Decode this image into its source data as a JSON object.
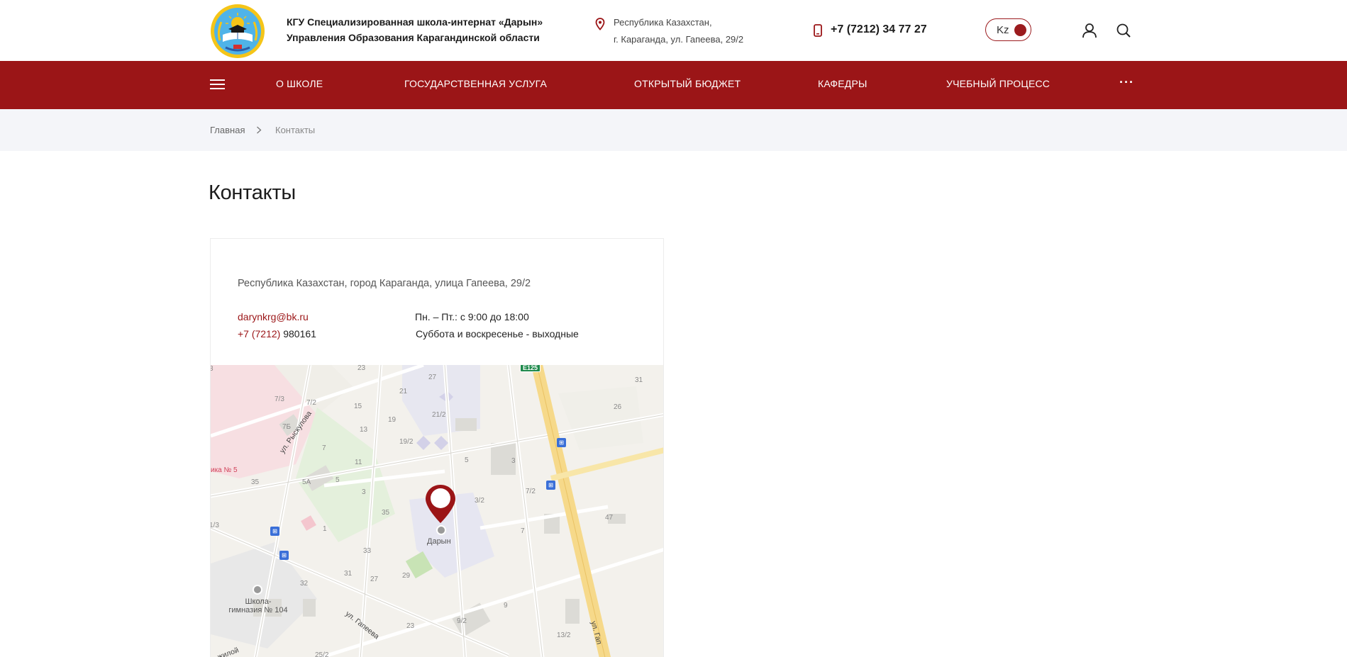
{
  "header": {
    "org_line1": "КГУ Специализированная школа-интернат «Дарын»",
    "org_line2": "Управления Образования Карагандинской области",
    "address_line1": "Республика Казахстан,",
    "address_line2": "г. Караганда, ул. Гапеева, 29/2",
    "phone": "+7 (7212) 34 77 27",
    "lang": "Kz",
    "icons": [
      "logo",
      "location-pin-icon",
      "phone-icon",
      "user-icon",
      "search-icon"
    ]
  },
  "nav": {
    "items": [
      {
        "label": "О ШКОЛЕ"
      },
      {
        "label": "ГОСУДАРСТВЕННАЯ УСЛУГА"
      },
      {
        "label": "ОТКРЫТЫЙ БЮДЖЕТ"
      },
      {
        "label": "КАФЕДРЫ"
      },
      {
        "label": "УЧЕБНЫЙ ПРОЦЕСС"
      }
    ],
    "more": "···",
    "icons": [
      "menu-icon",
      "more-icon"
    ]
  },
  "breadcrumb": {
    "home": "Главная",
    "current": "Контакты"
  },
  "page": {
    "title": "Контакты"
  },
  "contact_card": {
    "address": "Республика Казахстан, город Караганда, улица Гапеева, 29/2",
    "email": "darynkrg@bk.ru",
    "phone_code": "+7 (7212)",
    "phone_number": " 980161",
    "hours": "Пн. – Пт.: с 9:00 до 18:00",
    "weekend": "Суббота и воскресенье - выходные"
  },
  "map": {
    "pin_label": "Дарын",
    "school_label_1": "Школа-",
    "school_label_2": "гимназия № 104",
    "clinic_label": "ика № 5",
    "street_ryskulova": "ул. Рыскулова",
    "street_gapeeva": "ул. Гапеева",
    "street_gap_partial": "ул. Гап",
    "street_zhelez_partial": "а жилой",
    "road_sign": "E125",
    "house_numbers": [
      "23",
      "27",
      "31",
      "21",
      "7/3",
      "15",
      "7/2",
      "21/2",
      "26",
      "13",
      "19",
      "7Б",
      "19/2",
      "7",
      "11",
      "5",
      "3",
      "35",
      "5А",
      "5",
      "3",
      "3/2",
      "7/2",
      "35",
      "47",
      "1",
      "7",
      "33",
      "31",
      "27",
      "29",
      "32",
      "9",
      "9/2",
      "23",
      "13/2",
      "25/2",
      "1/3",
      "3"
    ]
  },
  "colors": {
    "brand": "#9b1517",
    "nav_bg": "#9b1517",
    "crumb_bg": "#f4f5f9"
  }
}
